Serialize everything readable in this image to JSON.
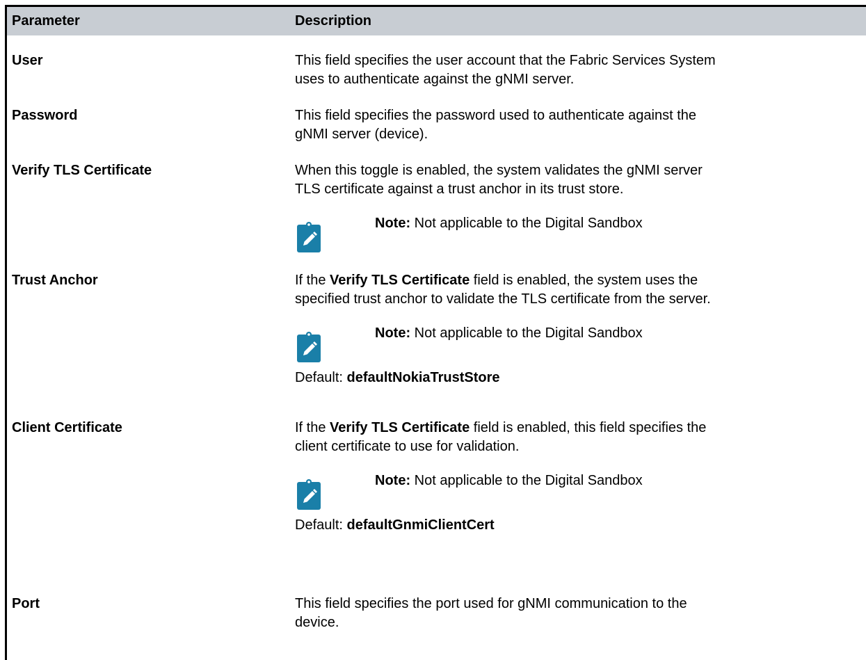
{
  "table": {
    "header": {
      "parameter": "Parameter",
      "description": "Description"
    },
    "rows": [
      {
        "parameter": "User",
        "description_lines": [
          "This field specifies the user account that the Fabric Services System",
          "uses to authenticate against the gNMI server."
        ]
      },
      {
        "parameter": "Password",
        "description_lines": [
          "This field specifies the password used to authenticate against the",
          "gNMI server (device)."
        ]
      },
      {
        "parameter": "Verify TLS Certificate",
        "description_lines": [
          "When this toggle is enabled, the system validates the gNMI server",
          "TLS certificate against a trust anchor in its trust store."
        ],
        "note_label": "Note:",
        "note_text": "Not applicable to the Digital Sandbox",
        "note_icon": "note-pencil-icon"
      },
      {
        "parameter": "Trust Anchor",
        "desc_prefix": "If the ",
        "desc_bold": "Verify TLS Certificate",
        "desc_suffix_line1": " field is enabled, the system uses the",
        "desc_line2": "specified trust anchor to validate the TLS certificate from the server.",
        "note_label": "Note:",
        "note_text": "Not applicable to the Digital Sandbox",
        "note_icon": "note-pencil-icon",
        "default_label": "Default: ",
        "default_value": "defaultNokiaTrustStore"
      },
      {
        "parameter": "Client Certificate",
        "desc_prefix": "If the ",
        "desc_bold": "Verify TLS Certificate",
        "desc_suffix_line1": " field is enabled, this field specifies the",
        "desc_line2": "client certificate to use for validation.",
        "note_label": "Note:",
        "note_text": "Not applicable to the Digital Sandbox",
        "note_icon": "note-pencil-icon",
        "default_label": "Default: ",
        "default_value": "defaultGnmiClientCert"
      },
      {
        "parameter": "Port",
        "description_lines": [
          "This field specifies the port used for gNMI communication to the",
          "device."
        ]
      }
    ]
  },
  "colors": {
    "header_bg": "#c8cdd3",
    "note_icon_bg": "#1a7fa8",
    "border": "#000000"
  }
}
